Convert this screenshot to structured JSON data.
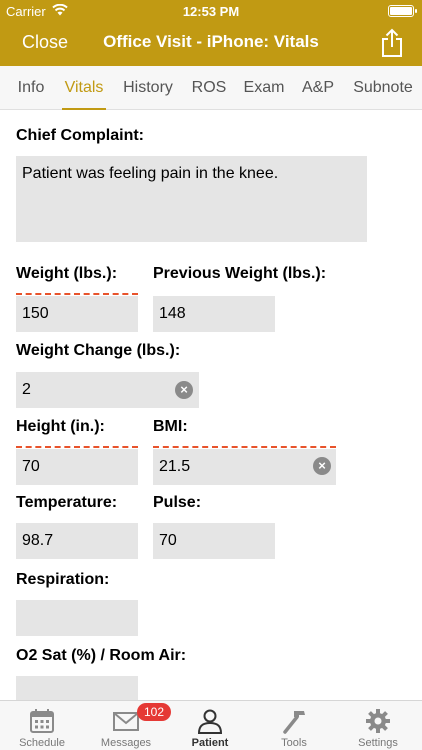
{
  "status_bar": {
    "carrier": "Carrier",
    "time": "12:53 PM"
  },
  "nav": {
    "close_label": "Close",
    "title": "Office Visit - iPhone: Vitals",
    "share_icon": "share-icon"
  },
  "tabs": [
    "Info",
    "Vitals",
    "History",
    "ROS",
    "Exam",
    "A&P",
    "Subnote"
  ],
  "active_tab": "Vitals",
  "form": {
    "chief_complaint": {
      "label": "Chief Complaint:",
      "value": "Patient was feeling pain in the knee."
    },
    "weight": {
      "label": "Weight (lbs.):",
      "value": "150"
    },
    "previous_weight": {
      "label": "Previous Weight (lbs.):",
      "value": "148"
    },
    "weight_change": {
      "label": "Weight Change (lbs.):",
      "value": "2"
    },
    "height": {
      "label": "Height (in.):",
      "value": "70"
    },
    "bmi": {
      "label": "BMI:",
      "value": "21.5"
    },
    "temperature": {
      "label": "Temperature:",
      "value": "98.7"
    },
    "pulse": {
      "label": "Pulse:",
      "value": "70"
    },
    "respiration": {
      "label": "Respiration:",
      "value": ""
    },
    "o2_sat": {
      "label": "O2 Sat (%) / Room Air:",
      "value": ""
    }
  },
  "tabbar": {
    "items": [
      {
        "label": "Schedule",
        "icon": "calendar-icon"
      },
      {
        "label": "Messages",
        "icon": "envelope-icon",
        "badge": "102"
      },
      {
        "label": "Patient",
        "icon": "person-icon"
      },
      {
        "label": "Tools",
        "icon": "hammer-icon"
      },
      {
        "label": "Settings",
        "icon": "gear-icon"
      }
    ],
    "active": "Patient"
  },
  "colors": {
    "accent": "#c19a13",
    "field_bg": "#e5e5e5",
    "required_dash": "#e8532b",
    "badge": "#e53935"
  }
}
